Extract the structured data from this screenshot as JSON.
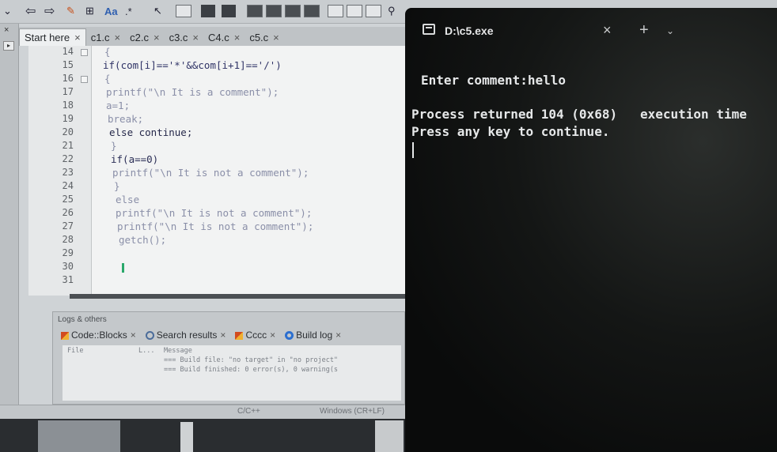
{
  "ide": {
    "tabs": [
      {
        "label": "Start here"
      },
      {
        "label": "c1.c"
      },
      {
        "label": "c2.c"
      },
      {
        "label": "c3.c"
      },
      {
        "label": "C4.c"
      },
      {
        "label": "c5.c"
      }
    ],
    "tab_close": "×",
    "lines": [
      {
        "num": "14",
        "code": "{"
      },
      {
        "num": "15",
        "code": "if(com[i]=='*'&&com[i+1]=='/')"
      },
      {
        "num": "16",
        "code": "{"
      },
      {
        "num": "17",
        "code": "printf(\"\\n It is a comment\");"
      },
      {
        "num": "18",
        "code": "a=1;"
      },
      {
        "num": "19",
        "code": "break;"
      },
      {
        "num": "20",
        "code": "else continue;"
      },
      {
        "num": "21",
        "code": "}"
      },
      {
        "num": "22",
        "code": "if(a==0)"
      },
      {
        "num": "23",
        "code": "printf(\"\\n It is not a comment\");"
      },
      {
        "num": "24",
        "code": "}"
      },
      {
        "num": "25",
        "code": "else"
      },
      {
        "num": "26",
        "code": "printf(\"\\n It is not a comment\");"
      },
      {
        "num": "27",
        "code": "printf(\"\\n It is not a comment\");"
      },
      {
        "num": "28",
        "code": "getch();"
      },
      {
        "num": "29",
        "code": ""
      },
      {
        "num": "30",
        "code": "}"
      },
      {
        "num": "31",
        "code": ""
      }
    ],
    "logs": {
      "title": "Logs & others",
      "tabs": [
        {
          "label": "Code::Blocks"
        },
        {
          "label": "Search results"
        },
        {
          "label": "Cccc"
        },
        {
          "label": "Build log"
        }
      ],
      "header_file": "File",
      "header_line": "L...",
      "header_message": "Message",
      "msg1": "=== Build file: \"no target\" in \"no project\"",
      "msg2": "=== Build finished: 0 error(s), 0 warning(s"
    },
    "status": {
      "language": "C/C++",
      "eol": "Windows (CR+LF)"
    }
  },
  "console": {
    "tab_title": "D:\\c5.exe",
    "close": "×",
    "new_tab": "+",
    "dropdown": "⌄",
    "output": {
      "line1": "Enter comment:hello",
      "line2": "Process returned 104 (0x68)   execution time",
      "line3": "Press any key to continue."
    }
  }
}
